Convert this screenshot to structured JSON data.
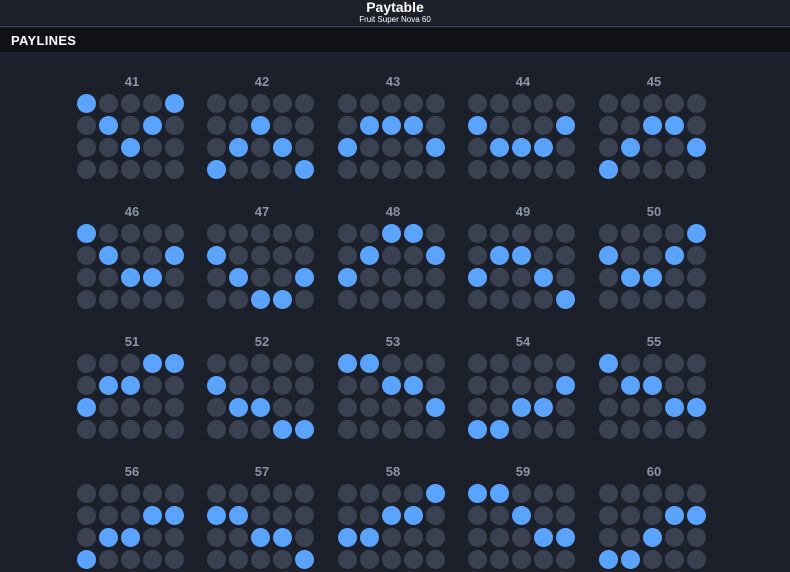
{
  "header": {
    "title": "Paytable",
    "subtitle": "Fruit Super Nova 60"
  },
  "section": {
    "title": "PAYLINES"
  },
  "colors": {
    "background": "#1c202b",
    "section_bar": "#0f1117",
    "cell_inactive": "#3a4252",
    "cell_active": "#5aa3ff",
    "number_text": "#8b93a7"
  },
  "paylines": [
    {
      "number": "41",
      "rows": [
        0,
        1,
        2,
        1,
        0
      ]
    },
    {
      "number": "42",
      "rows": [
        3,
        2,
        1,
        2,
        3
      ]
    },
    {
      "number": "43",
      "rows": [
        2,
        1,
        1,
        1,
        2
      ]
    },
    {
      "number": "44",
      "rows": [
        1,
        2,
        2,
        2,
        1
      ]
    },
    {
      "number": "45",
      "rows": [
        3,
        2,
        1,
        1,
        2
      ]
    },
    {
      "number": "46",
      "rows": [
        0,
        1,
        2,
        2,
        1
      ]
    },
    {
      "number": "47",
      "rows": [
        1,
        2,
        3,
        3,
        2
      ]
    },
    {
      "number": "48",
      "rows": [
        2,
        1,
        0,
        0,
        1
      ]
    },
    {
      "number": "49",
      "rows": [
        2,
        1,
        1,
        2,
        3
      ]
    },
    {
      "number": "50",
      "rows": [
        1,
        2,
        2,
        1,
        0
      ]
    },
    {
      "number": "51",
      "rows": [
        2,
        1,
        1,
        0,
        0
      ]
    },
    {
      "number": "52",
      "rows": [
        1,
        2,
        2,
        3,
        3
      ]
    },
    {
      "number": "53",
      "rows": [
        0,
        0,
        1,
        1,
        2
      ]
    },
    {
      "number": "54",
      "rows": [
        3,
        3,
        2,
        2,
        1
      ]
    },
    {
      "number": "55",
      "rows": [
        0,
        1,
        1,
        2,
        2
      ]
    },
    {
      "number": "56",
      "rows": [
        3,
        2,
        2,
        1,
        1
      ]
    },
    {
      "number": "57",
      "rows": [
        1,
        1,
        2,
        2,
        3
      ]
    },
    {
      "number": "58",
      "rows": [
        2,
        2,
        1,
        1,
        0
      ]
    },
    {
      "number": "59",
      "rows": [
        0,
        0,
        1,
        2,
        2
      ]
    },
    {
      "number": "60",
      "rows": [
        3,
        3,
        2,
        1,
        1
      ]
    }
  ]
}
